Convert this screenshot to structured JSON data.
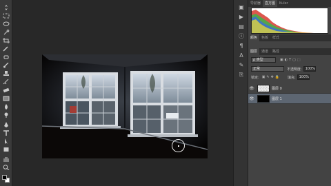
{
  "tools": [
    "move-tool",
    "marquee-tool",
    "lasso-tool",
    "quick-select-tool",
    "crop-tool",
    "eyedropper-tool",
    "healing-brush-tool",
    "brush-tool",
    "clone-stamp-tool",
    "history-brush-tool",
    "eraser-tool",
    "gradient-tool",
    "blur-tool",
    "dodge-tool",
    "pen-tool",
    "type-tool",
    "path-select-tool",
    "shape-tool",
    "hand-tool",
    "zoom-tool"
  ],
  "histogram_tabs": [
    "导航器",
    "直方图",
    "Kuler"
  ],
  "adjust_tabs": [
    "颜色",
    "色板",
    "样式"
  ],
  "layers_tabs": [
    "图层",
    "通道",
    "路径"
  ],
  "layers": {
    "filter_kind": "类型",
    "blend_mode": "正常",
    "opacity_label": "不透明度:",
    "opacity_value": "100%",
    "lock_label": "锁定:",
    "fill_label": "填充:",
    "fill_value": "100%",
    "items": [
      {
        "name": "图层 0",
        "selected": false
      },
      {
        "name": "图层 1",
        "selected": true
      }
    ]
  },
  "colors": {
    "foreground": "#000000",
    "background": "#ffffff",
    "selected_layer": "#5d6672"
  }
}
